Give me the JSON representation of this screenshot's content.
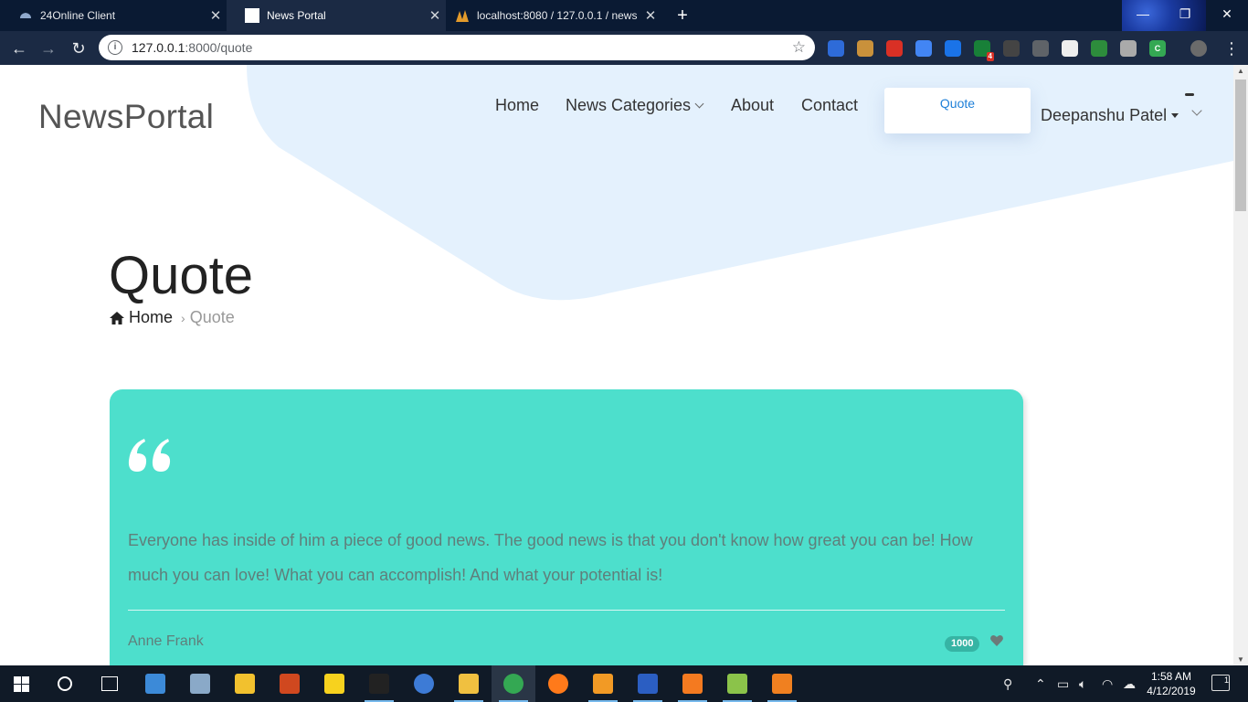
{
  "browser": {
    "tabs": [
      {
        "title": "24Online Client",
        "active": false
      },
      {
        "title": "News Portal",
        "active": true
      },
      {
        "title": "localhost:8080 / 127.0.0.1 / news",
        "active": false
      }
    ],
    "address": {
      "host": "127.0.0.1",
      "path": ":8000/quote"
    },
    "extensions": [
      {
        "icon": "toggle-icon",
        "color": "#2e6bd8"
      },
      {
        "icon": "cookie-icon",
        "color": "#c9913b"
      },
      {
        "icon": "shield-icon",
        "color": "#d93025"
      },
      {
        "icon": "translate-icon",
        "color": "#4285f4"
      },
      {
        "icon": "ip-icon",
        "color": "#1a73e8"
      },
      {
        "icon": "ip-badge-icon",
        "color": "#188038",
        "badge": "4"
      },
      {
        "icon": "video-icon",
        "color": "#444444"
      },
      {
        "icon": "pen-icon",
        "color": "#5f6368"
      },
      {
        "icon": "circle-icon",
        "color": "#eeeeee"
      },
      {
        "icon": "earth-icon",
        "color": "#2d8c3c"
      },
      {
        "icon": "drive-icon",
        "color": "#aaaaaa"
      },
      {
        "icon": "cors-icon",
        "color": "#34a853",
        "label": "CORS"
      }
    ]
  },
  "site": {
    "brand": "NewsPortal",
    "nav": {
      "home": "Home",
      "categories": "News Categories",
      "about": "About",
      "contact": "Contact",
      "quote": "Quote",
      "user": "Deepanshu Patel"
    },
    "page_title": "Quote",
    "breadcrumb": {
      "home": "Home",
      "current": "Quote"
    },
    "quote_card": {
      "text": "Everyone has inside of him a piece of good news. The good news is that you don't know how great you can be! How much you can love! What you can accomplish! And what your potential is!",
      "author": "Anne Frank",
      "likes": "1000",
      "bg_color": "#4ddfcc"
    },
    "colors": {
      "accent": "#1d7fd8",
      "blob": "#e4f1fd"
    }
  },
  "taskbar": {
    "clock_time": "1:58 AM",
    "clock_date": "4/12/2019",
    "notifications": "1",
    "apps": [
      {
        "icon": "task-manager-icon",
        "color": "#3c8ad8"
      },
      {
        "icon": "control-panel-icon",
        "color": "#8aa9c8"
      },
      {
        "icon": "store-icon",
        "color": "#f2c12e"
      },
      {
        "icon": "postman-icon",
        "color": "#d0481f"
      },
      {
        "icon": "sticky-notes-icon",
        "color": "#f7d21e"
      },
      {
        "icon": "terminal-icon",
        "color": "#222222"
      },
      {
        "icon": "qbittorrent-icon",
        "color": "#3d7bd6"
      },
      {
        "icon": "file-explorer-icon",
        "color": "#f0c040"
      },
      {
        "icon": "chrome-icon",
        "color": "#34a853"
      },
      {
        "icon": "firefox-icon",
        "color": "#ff7a1a"
      },
      {
        "icon": "sublime-icon",
        "color": "#f29a25"
      },
      {
        "icon": "devcpp-icon",
        "color": "#2b5ec2"
      },
      {
        "icon": "xampp-icon",
        "color": "#f47a20"
      },
      {
        "icon": "notepadpp-icon",
        "color": "#8bc34a"
      },
      {
        "icon": "vlc-icon",
        "color": "#f08020"
      }
    ]
  }
}
